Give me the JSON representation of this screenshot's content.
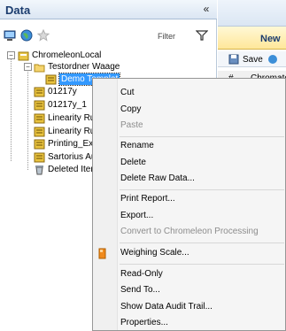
{
  "panel": {
    "title": "Data",
    "collapse_glyph": "«",
    "filter_label": "Filter"
  },
  "tree": {
    "root": "ChromeleonLocal",
    "folder": "Testordner Waage",
    "selected": "Demo Templat",
    "items": [
      "01217y",
      "01217y_1",
      "Linearity Run",
      "Linearity Run",
      "Printing_Expe",
      "Sartorius Aus",
      "Deleted Item"
    ]
  },
  "right": {
    "new_label": "New",
    "save_label": "Save",
    "hash_col": "#",
    "chrom_col": "Chromato"
  },
  "menu": {
    "items": [
      {
        "label": "Cut",
        "enabled": true
      },
      {
        "label": "Copy",
        "enabled": true
      },
      {
        "label": "Paste",
        "enabled": false
      },
      {
        "label": "Rename",
        "enabled": true
      },
      {
        "label": "Delete",
        "enabled": true
      },
      {
        "label": "Delete Raw Data...",
        "enabled": true
      },
      {
        "label": "Print Report...",
        "enabled": true
      },
      {
        "label": "Export...",
        "enabled": true
      },
      {
        "label": "Convert to Chromeleon Processing",
        "enabled": false
      },
      {
        "label": "Weighing Scale...",
        "enabled": true,
        "icon": "weighing-scale-icon"
      },
      {
        "label": "Read-Only",
        "enabled": true
      },
      {
        "label": "Send To...",
        "enabled": true
      },
      {
        "label": "Show Data Audit Trail...",
        "enabled": true
      },
      {
        "label": "Properties...",
        "enabled": true
      }
    ]
  },
  "colors": {
    "selection": "#3399ff",
    "header_text": "#1b3c6e",
    "menu_bg": "#f5f5f5"
  }
}
